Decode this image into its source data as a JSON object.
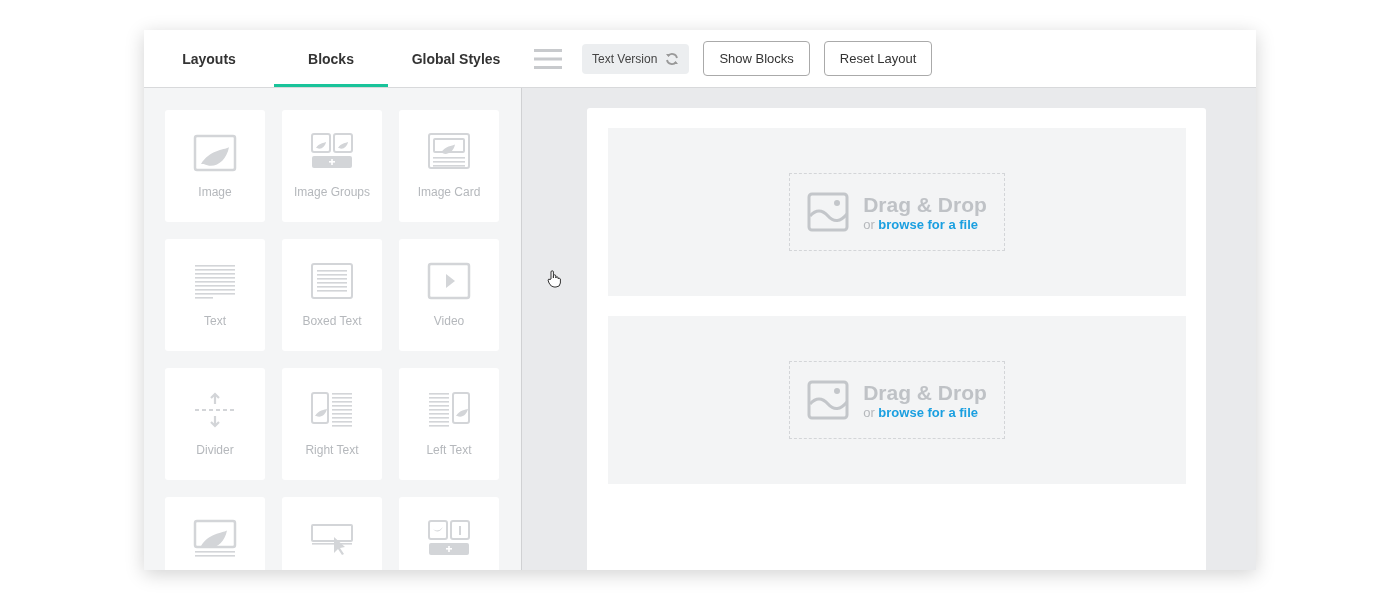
{
  "tabs": [
    {
      "label": "Layouts",
      "selected": false
    },
    {
      "label": "Blocks",
      "selected": true
    },
    {
      "label": "Global Styles",
      "selected": false
    }
  ],
  "toolbar": {
    "text_version": "Text Version",
    "buttons": [
      "Show Blocks",
      "Reset Layout"
    ]
  },
  "blocks": [
    {
      "kind": "image",
      "label": "Image"
    },
    {
      "kind": "image-groups",
      "label": "Image Groups"
    },
    {
      "kind": "image-card",
      "label": "Image Card"
    },
    {
      "kind": "text",
      "label": "Text"
    },
    {
      "kind": "boxed-text",
      "label": "Boxed Text"
    },
    {
      "kind": "video",
      "label": "Video"
    },
    {
      "kind": "divider",
      "label": "Divider"
    },
    {
      "kind": "right-text",
      "label": "Right Text"
    },
    {
      "kind": "left-text",
      "label": "Left Text"
    },
    {
      "kind": "image-caption"
    },
    {
      "kind": "button"
    },
    {
      "kind": "social"
    }
  ],
  "drop_zones": [
    {
      "title": "Drag & Drop",
      "prefix": "or",
      "link": "browse for a file"
    },
    {
      "title": "Drag & Drop",
      "prefix": "or",
      "link": "browse for a file"
    }
  ]
}
